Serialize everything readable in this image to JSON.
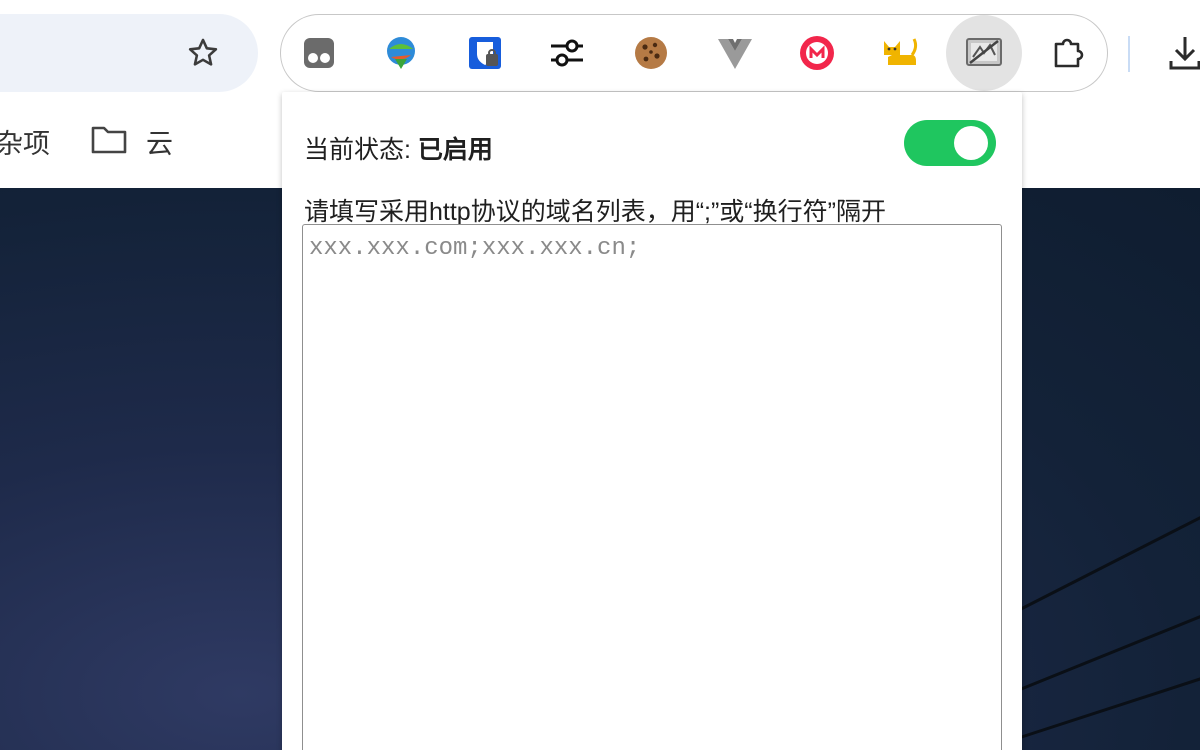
{
  "toolbar": {
    "extensions": [
      {
        "name": "tampermonkey-icon"
      },
      {
        "name": "internet-download-manager-icon"
      },
      {
        "name": "bitwarden-icon"
      },
      {
        "name": "sliders-icon"
      },
      {
        "name": "cookie-icon"
      },
      {
        "name": "vue-devtools-icon"
      },
      {
        "name": "m-circle-icon"
      },
      {
        "name": "cat-icon"
      },
      {
        "name": "http-switch-icon"
      },
      {
        "name": "puzzle-icon"
      }
    ]
  },
  "bookmarks": {
    "items": [
      {
        "label": "杂项"
      },
      {
        "label": "云"
      }
    ]
  },
  "popup": {
    "status_label": "当前状态:",
    "status_value": "已启用",
    "toggle_on": true,
    "instruction": "请填写采用http协议的域名列表，用“;”或“换行符”隔开",
    "textarea_value": "",
    "textarea_placeholder": "xxx.xxx.com;xxx.xxx.cn;"
  },
  "colors": {
    "toggle_on": "#1fc65f",
    "omnibox_bg": "#eef2f9",
    "page_bg": "#132238"
  }
}
